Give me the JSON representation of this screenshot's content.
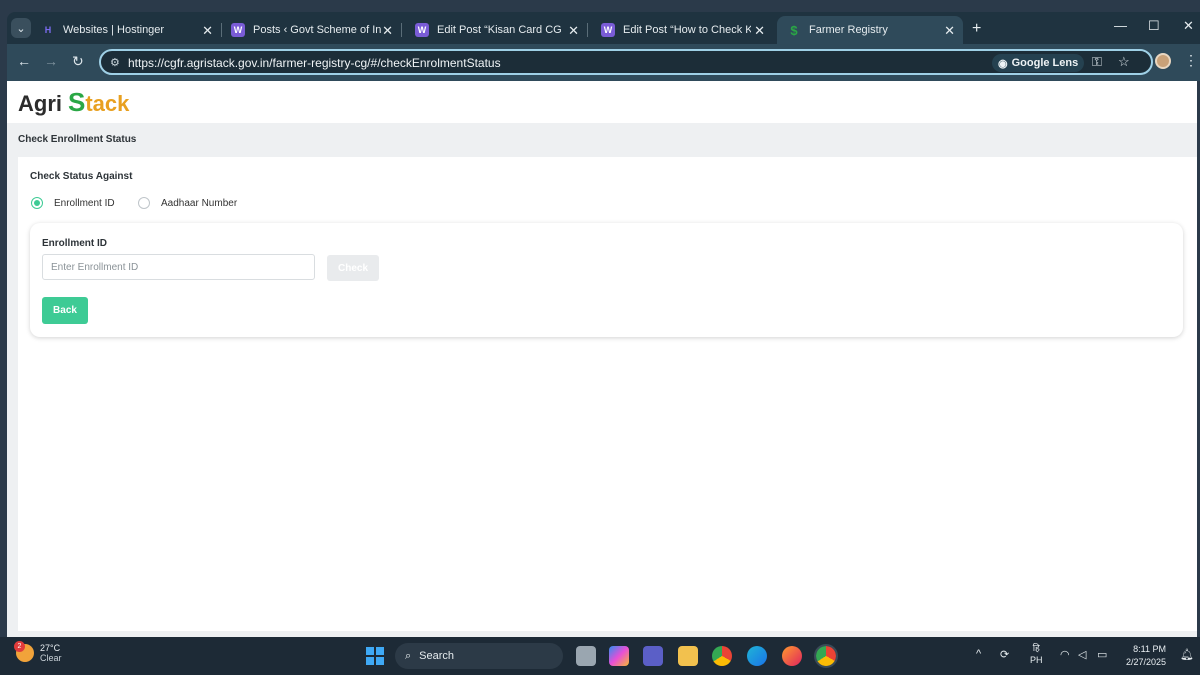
{
  "browser": {
    "tabs": [
      {
        "title": "Websites | Hostinger",
        "favicon": "hostinger-icon",
        "color": "#7b6cf0",
        "glyph": "H"
      },
      {
        "title": "Posts ‹ Govt Scheme of Ind — W",
        "favicon": "wordpress-icon",
        "color": "#7a5cd6",
        "glyph": "W"
      },
      {
        "title": "Edit Post “Kisan Card CG Online",
        "favicon": "wordpress-icon",
        "color": "#7a5cd6",
        "glyph": "W"
      },
      {
        "title": "Edit Post “How to Check Kisan C",
        "favicon": "wordpress-icon",
        "color": "#7a5cd6",
        "glyph": "W"
      },
      {
        "title": "Farmer Registry",
        "favicon": "agristack-icon",
        "color": "#2aa745",
        "glyph": "$"
      }
    ],
    "new_tab": "+",
    "url": "https://cgfr.agristack.gov.in/farmer-registry-cg/#/checkEnrolmentStatus",
    "lens_label": "Google Lens"
  },
  "page": {
    "logo_part1": "Agri",
    "logo_part2": "S",
    "logo_part3": "tack",
    "subheader": "Check Enrollment Status",
    "status_label": "Check Status Against",
    "radio_enrollment": "Enrollment ID",
    "radio_aadhaar": "Aadhaar Number",
    "field_label": "Enrollment ID",
    "field_placeholder": "Enter Enrollment ID",
    "check_button": "Check",
    "back_button": "Back",
    "accent_color": "#3ecb95"
  },
  "taskbar": {
    "temperature": "27°C",
    "condition": "Clear",
    "weather_badge": "2",
    "search_label": "Search",
    "lang_top": "हि",
    "lang_bottom": "PH",
    "time": "8:11 PM",
    "date": "2/27/2025"
  }
}
